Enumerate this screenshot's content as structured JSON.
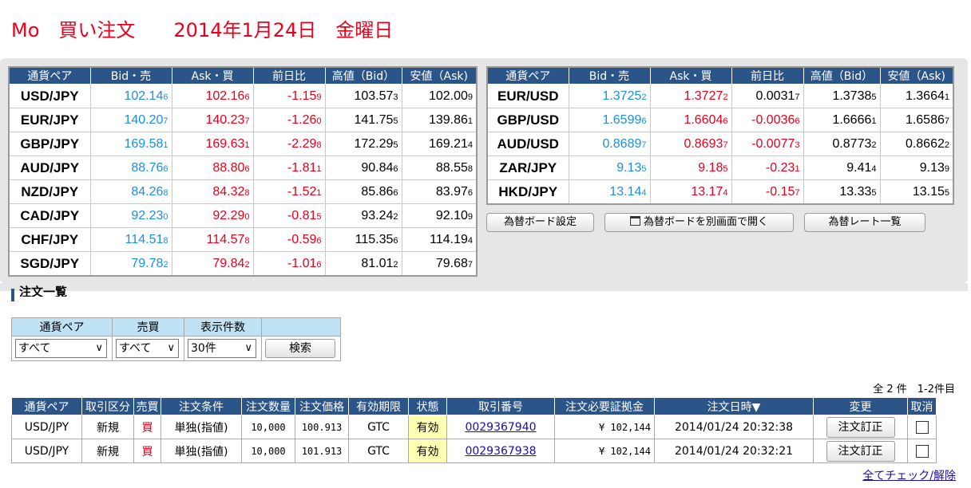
{
  "header": {
    "user": "Mo",
    "page_title": "買い注文",
    "date": "2014年1月24日",
    "weekday": "金曜日"
  },
  "rates": {
    "columns": [
      "通貨ペア",
      "Bid・売",
      "Ask・買",
      "前日比",
      "高値（Bid）",
      "安値（Ask)"
    ],
    "left": [
      {
        "pair": "USD/JPY",
        "bid": "102.14",
        "bid_s": "6",
        "ask": "102.16",
        "ask_s": "6",
        "chg": "-1.15",
        "chg_s": "9",
        "high": "103.57",
        "high_s": "3",
        "low": "102.00",
        "low_s": "9"
      },
      {
        "pair": "EUR/JPY",
        "bid": "140.20",
        "bid_s": "7",
        "ask": "140.23",
        "ask_s": "7",
        "chg": "-1.26",
        "chg_s": "0",
        "high": "141.75",
        "high_s": "5",
        "low": "139.86",
        "low_s": "1"
      },
      {
        "pair": "GBP/JPY",
        "bid": "169.58",
        "bid_s": "1",
        "ask": "169.63",
        "ask_s": "1",
        "chg": "-2.29",
        "chg_s": "8",
        "high": "172.29",
        "high_s": "5",
        "low": "169.21",
        "low_s": "4"
      },
      {
        "pair": "AUD/JPY",
        "bid": "88.76",
        "bid_s": "6",
        "ask": "88.80",
        "ask_s": "6",
        "chg": "-1.81",
        "chg_s": "1",
        "high": "90.84",
        "high_s": "6",
        "low": "88.55",
        "low_s": "8"
      },
      {
        "pair": "NZD/JPY",
        "bid": "84.26",
        "bid_s": "8",
        "ask": "84.32",
        "ask_s": "8",
        "chg": "-1.52",
        "chg_s": "1",
        "high": "85.86",
        "high_s": "6",
        "low": "83.97",
        "low_s": "6"
      },
      {
        "pair": "CAD/JPY",
        "bid": "92.23",
        "bid_s": "0",
        "ask": "92.29",
        "ask_s": "0",
        "chg": "-0.81",
        "chg_s": "5",
        "high": "93.24",
        "high_s": "2",
        "low": "92.10",
        "low_s": "9"
      },
      {
        "pair": "CHF/JPY",
        "bid": "114.51",
        "bid_s": "8",
        "ask": "114.57",
        "ask_s": "8",
        "chg": "-0.59",
        "chg_s": "6",
        "high": "115.35",
        "high_s": "6",
        "low": "114.19",
        "low_s": "4"
      },
      {
        "pair": "SGD/JPY",
        "bid": "79.78",
        "bid_s": "2",
        "ask": "79.84",
        "ask_s": "2",
        "chg": "-1.01",
        "chg_s": "6",
        "high": "81.01",
        "high_s": "2",
        "low": "79.68",
        "low_s": "7"
      }
    ],
    "right": [
      {
        "pair": "EUR/USD",
        "bid": "1.3725",
        "bid_s": "2",
        "ask": "1.3727",
        "ask_s": "2",
        "chg": "0.0031",
        "chg_s": "7",
        "high": "1.3738",
        "high_s": "5",
        "low": "1.3664",
        "low_s": "1"
      },
      {
        "pair": "GBP/USD",
        "bid": "1.6599",
        "bid_s": "6",
        "ask": "1.6604",
        "ask_s": "6",
        "chg": "-0.0036",
        "chg_s": "6",
        "high": "1.6666",
        "high_s": "1",
        "low": "1.6586",
        "low_s": "7"
      },
      {
        "pair": "AUD/USD",
        "bid": "0.8689",
        "bid_s": "7",
        "ask": "0.8693",
        "ask_s": "7",
        "chg": "-0.0077",
        "chg_s": "3",
        "high": "0.8773",
        "high_s": "2",
        "low": "0.8662",
        "low_s": "2"
      },
      {
        "pair": "ZAR/JPY",
        "bid": "9.13",
        "bid_s": "5",
        "ask": "9.18",
        "ask_s": "5",
        "chg": "-0.23",
        "chg_s": "1",
        "high": "9.41",
        "high_s": "4",
        "low": "9.13",
        "low_s": "9"
      },
      {
        "pair": "HKD/JPY",
        "bid": "13.14",
        "bid_s": "4",
        "ask": "13.17",
        "ask_s": "4",
        "chg": "-0.15",
        "chg_s": "7",
        "high": "13.33",
        "high_s": "5",
        "low": "13.15",
        "low_s": "5"
      }
    ]
  },
  "board_buttons": {
    "settings": "為替ボード設定",
    "open_window": "為替ボードを別画面で開く",
    "rate_list": "為替レート一覧"
  },
  "order_section": {
    "title": "注文一覧"
  },
  "filter": {
    "headers": [
      "通貨ペア",
      "売買",
      "表示件数"
    ],
    "pair_value": "すべて",
    "side_value": "すべて",
    "count_value": "30件",
    "search_label": "検索"
  },
  "result_count": "全 2 件　1-2件目",
  "orders": {
    "columns": [
      "通貨ペア",
      "取引区分",
      "売買",
      "注文条件",
      "注文数量",
      "注文価格",
      "有効期限",
      "状態",
      "取引番号",
      "注文必要証拠金",
      "注文日時▼",
      "変更",
      "取消"
    ],
    "rows": [
      {
        "pair": "USD/JPY",
        "type": "新規",
        "side": "買",
        "condition": "単独(指値)",
        "qty": "10,000",
        "price": "100.913",
        "expiry": "GTC",
        "status": "有効",
        "id": "0029367940",
        "margin": "¥ 102,144",
        "datetime": "2014/01/24 20:32:38",
        "edit": "注文訂正"
      },
      {
        "pair": "USD/JPY",
        "type": "新規",
        "side": "買",
        "condition": "単独(指値)",
        "qty": "10,000",
        "price": "101.913",
        "expiry": "GTC",
        "status": "有効",
        "id": "0029367938",
        "margin": "¥ 102,144",
        "datetime": "2014/01/24 20:32:21",
        "edit": "注文訂正"
      }
    ]
  },
  "check_all": "全てチェック/解除",
  "colors": {
    "accent": "#2b5588",
    "bid": "#1e8ee0",
    "ask": "#e8001c",
    "filter_header": "#bfe2f5",
    "valid_status": "#ffffb3"
  }
}
